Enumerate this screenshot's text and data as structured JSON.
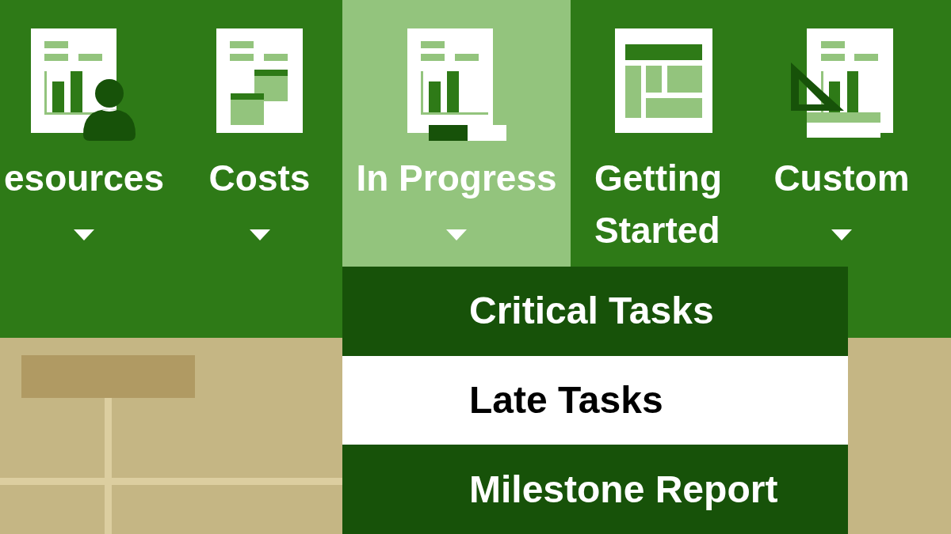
{
  "ribbon": {
    "buttons": [
      {
        "label": "esources",
        "kind": "resources",
        "selected": false,
        "dropdown": true
      },
      {
        "label": "Costs",
        "kind": "costs",
        "selected": false,
        "dropdown": true
      },
      {
        "label": "In Progress",
        "kind": "progress",
        "selected": true,
        "dropdown": true
      },
      {
        "label": "Getting Started",
        "kind": "dashboard",
        "selected": false,
        "dropdown": false
      },
      {
        "label": "Custom",
        "kind": "custom",
        "selected": false,
        "dropdown": true
      }
    ]
  },
  "dropdown_menu": {
    "items": [
      {
        "label": "Critical Tasks",
        "selected": false
      },
      {
        "label": "Late Tasks",
        "selected": true
      },
      {
        "label": "Milestone Report",
        "selected": false
      }
    ]
  }
}
